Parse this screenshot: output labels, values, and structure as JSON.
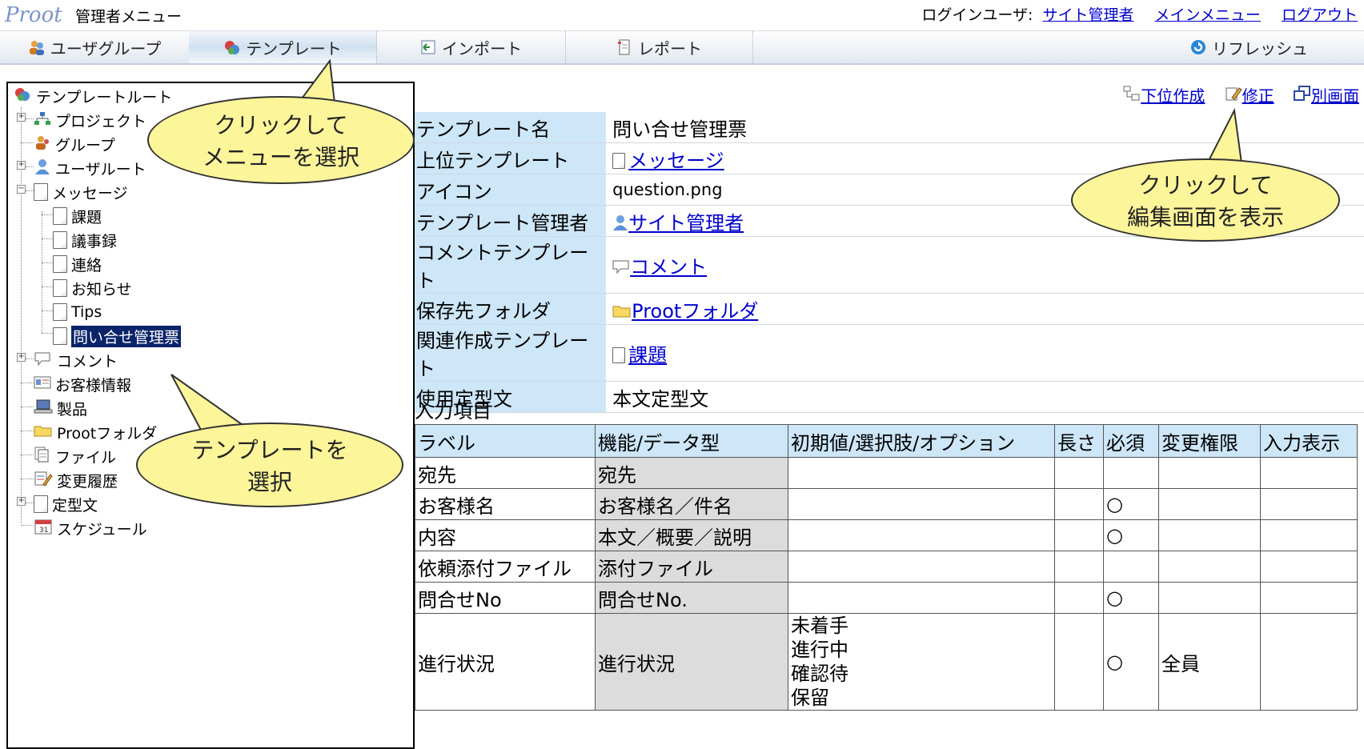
{
  "header": {
    "logo": "Proot",
    "admin_title": "管理者メニュー",
    "login_label": "ログインユーザ:",
    "login_user": "サイト管理者",
    "main_menu": "メインメニュー",
    "logout": "ログアウト"
  },
  "toolbar": {
    "items": [
      {
        "label": "ユーザグループ",
        "icon": "users-icon"
      },
      {
        "label": "テンプレート",
        "icon": "template-icon"
      },
      {
        "label": "インポート",
        "icon": "import-icon"
      },
      {
        "label": "レポート",
        "icon": "report-icon"
      },
      {
        "label": "リフレッシュ",
        "icon": "refresh-icon"
      }
    ]
  },
  "tree": {
    "root": "テンプレートルート",
    "project": "プロジェクト",
    "group": "グループ",
    "user_root": "ユーザルート",
    "message": "メッセージ",
    "children": [
      "課題",
      "議事録",
      "連絡",
      "お知らせ",
      "Tips",
      "問い合せ管理票"
    ],
    "comment": "コメント",
    "customer": "お客様情報",
    "product": "製品",
    "folder": "Prootフォルダ",
    "file": "ファイル",
    "history": "変更履歴",
    "template_text": "定型文",
    "schedule": "スケジュール"
  },
  "actions": {
    "create_child": "下位作成",
    "edit": "修正",
    "new_window": "別画面"
  },
  "info": {
    "rows": [
      {
        "key": "テンプレート名",
        "value": "問い合せ管理票"
      },
      {
        "key": "上位テンプレート",
        "value": "メッセージ"
      },
      {
        "key": "アイコン",
        "value": "question.png"
      },
      {
        "key": "テンプレート管理者",
        "value": "サイト管理者"
      },
      {
        "key": "コメントテンプレート",
        "value": "コメント"
      },
      {
        "key": "保存先フォルダ",
        "value": "Prootフォルダ"
      },
      {
        "key": "関連作成テンプレート",
        "value": "課題"
      },
      {
        "key": "使用定型文",
        "value": "本文定型文"
      }
    ]
  },
  "fields": {
    "section_title": "入力項目",
    "headers": [
      "ラベル",
      "機能/データ型",
      "初期値/選択肢/オプション",
      "長さ",
      "必須",
      "変更権限",
      "入力表示"
    ],
    "rows": [
      {
        "label": "宛先",
        "type": "宛先",
        "required": ""
      },
      {
        "label": "お客様名",
        "type": "お客様名／件名",
        "required": "○"
      },
      {
        "label": "内容",
        "type": "本文／概要／説明",
        "required": "○"
      },
      {
        "label": "依頼添付ファイル",
        "type": "添付ファイル",
        "required": ""
      },
      {
        "label": "問合せNo",
        "type": "問合せNo.",
        "required": "○"
      },
      {
        "label": "進行状況",
        "type": "進行状況",
        "required": "○",
        "permission": "全員",
        "options": [
          "未着手",
          "進行中",
          "確認待",
          "保留"
        ]
      }
    ]
  },
  "callouts": {
    "menu_line1": "クリックして",
    "menu_line2": "メニューを選択",
    "edit_line1": "クリックして",
    "edit_line2": "編集画面を表示",
    "tree_line1": "テンプレートを",
    "tree_line2": "選択"
  }
}
